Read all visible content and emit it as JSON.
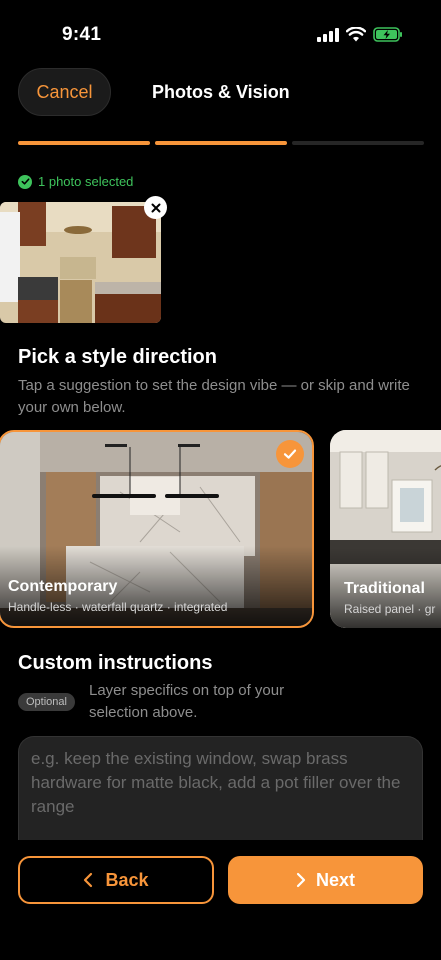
{
  "status_bar": {
    "time": "9:41"
  },
  "header": {
    "cancel_label": "Cancel",
    "title": "Photos & Vision"
  },
  "progress": {
    "current_step": 2,
    "total_steps": 3
  },
  "photos": {
    "selected_label": "1 photo selected"
  },
  "style": {
    "title": "Pick a style direction",
    "subtitle": "Tap a suggestion to set the design vibe — or skip and write your own below.",
    "cards": [
      {
        "name": "Contemporary",
        "desc": "Handle-less · waterfall quartz · integrated",
        "selected": true
      },
      {
        "name": "Traditional",
        "desc": "Raised panel · gr",
        "selected": false
      }
    ]
  },
  "custom": {
    "title": "Custom instructions",
    "badge": "Optional",
    "help": "Layer specifics on top of your selection above.",
    "placeholder": "e.g. keep the existing window, swap brass hardware for matte black, add a pot filler over the range"
  },
  "footer": {
    "back_label": "Back",
    "next_label": "Next"
  },
  "colors": {
    "accent": "#f7953a",
    "success": "#3ec35c",
    "background": "#000000"
  }
}
